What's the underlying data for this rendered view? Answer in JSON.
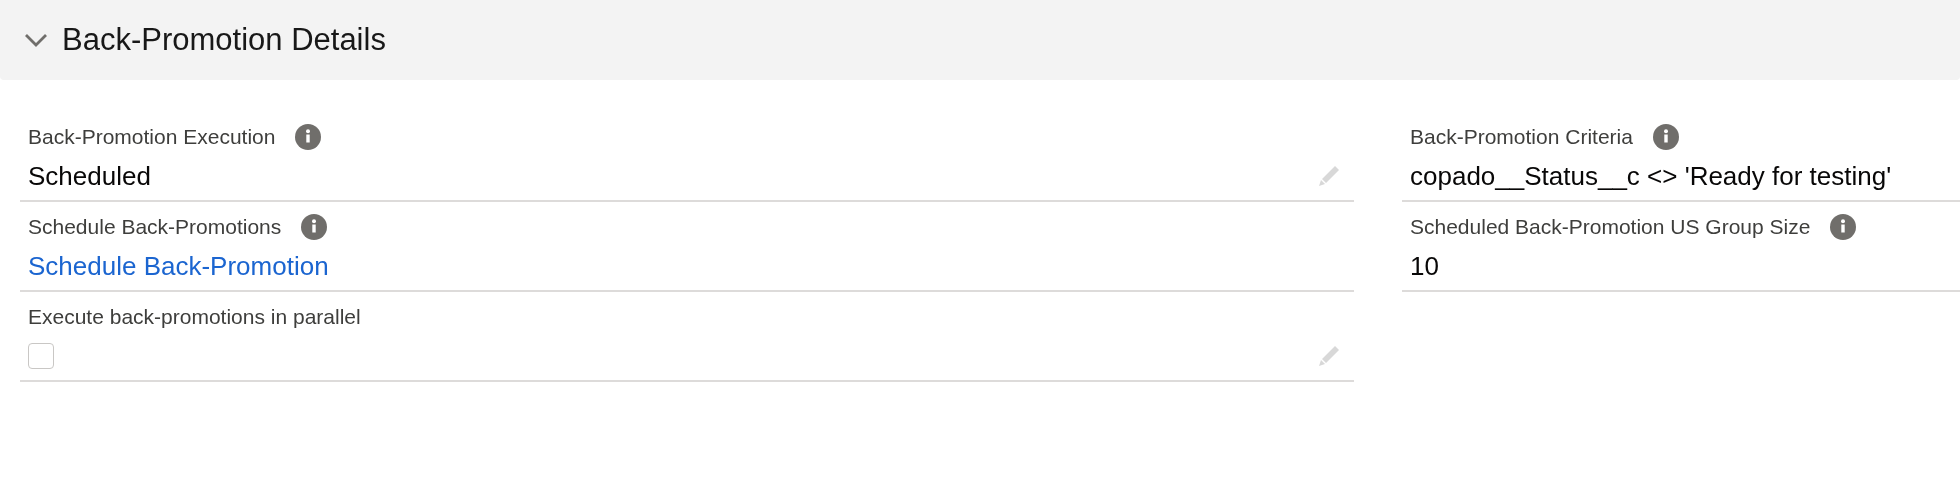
{
  "section": {
    "title": "Back-Promotion Details",
    "expanded": true
  },
  "columns": [
    {
      "fields": [
        {
          "kind": "text",
          "label": "Back-Promotion Execution",
          "info": true,
          "value": "Scheduled",
          "editable": true
        },
        {
          "kind": "link",
          "label": "Schedule Back-Promotions",
          "info": true,
          "value": "Schedule Back-Promotion",
          "editable": false
        },
        {
          "kind": "checkbox",
          "label": "Execute back-promotions in parallel",
          "info": false,
          "checked": false,
          "editable": true
        }
      ]
    },
    {
      "fields": [
        {
          "kind": "text",
          "label": "Back-Promotion Criteria",
          "info": true,
          "value": "copado__Status__c <> 'Ready for testing'",
          "editable": false
        },
        {
          "kind": "text",
          "label": "Scheduled Back-Promotion US Group Size",
          "info": true,
          "value": "10",
          "editable": false
        }
      ]
    }
  ]
}
